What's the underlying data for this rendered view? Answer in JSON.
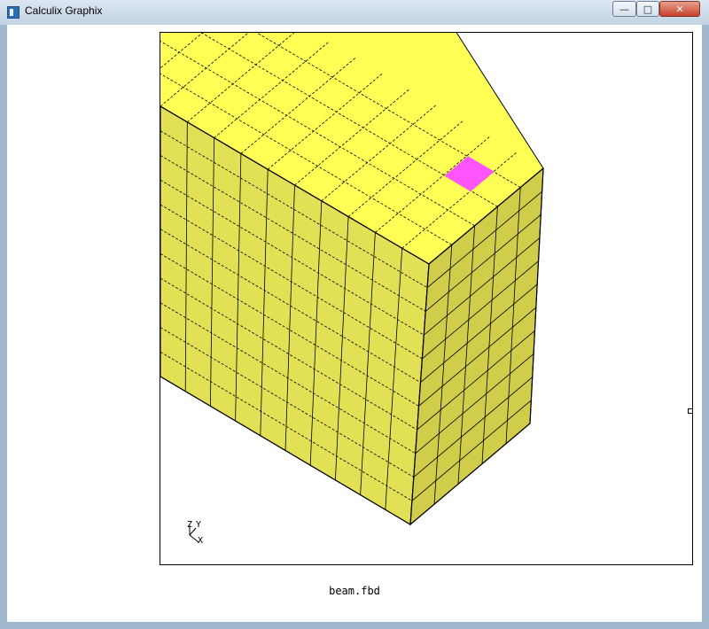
{
  "window": {
    "title": "Calculix Graphix",
    "minimize_glyph": "—",
    "maximize_glyph": "□",
    "close_glyph": "✕"
  },
  "viewport": {
    "filename": "beam.fbd",
    "axis_labels": {
      "z": "Z",
      "y": "Y",
      "x": "X"
    }
  },
  "colors": {
    "mesh_top": "#ffff55",
    "mesh_side": "#e2e055",
    "mesh_front": "#cfcd4a",
    "selected_element": "#ff55ff",
    "edge_lines": "#000000"
  },
  "icons": {
    "app": "calculix-app-icon",
    "minimize": "minimize-icon",
    "maximize": "maximize-icon",
    "close": "close-icon"
  }
}
